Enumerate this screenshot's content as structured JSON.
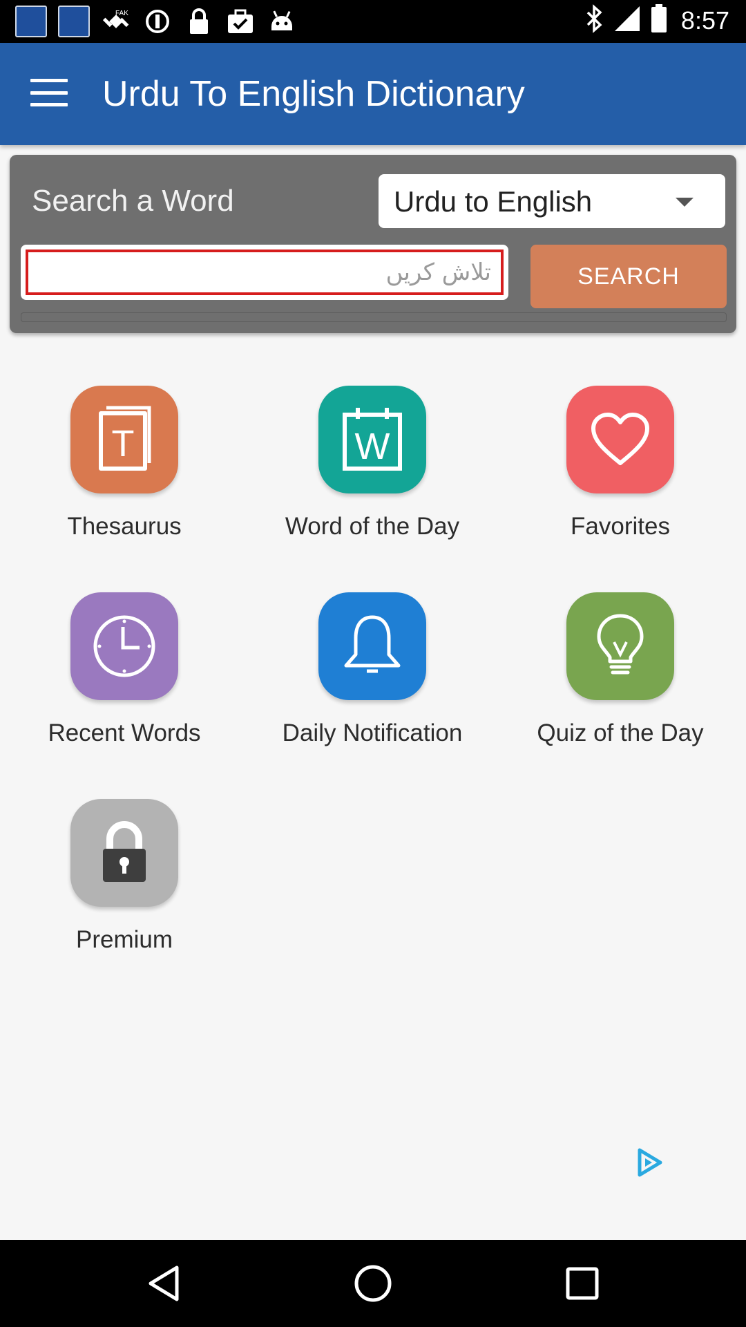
{
  "status_bar": {
    "time": "8:57",
    "left_icons": [
      "app-notification-icon",
      "app-notification-icon",
      "fake-gps-icon",
      "sync-icon",
      "lock-icon",
      "briefcase-check-icon",
      "android-icon"
    ],
    "right_icons": [
      "bluetooth-icon",
      "signal-icon",
      "battery-icon"
    ]
  },
  "app_bar": {
    "title": "Urdu To English Dictionary",
    "color": "#245ea8"
  },
  "search": {
    "label": "Search a Word",
    "language_selected": "Urdu to English",
    "input_placeholder": "تلاش کریں",
    "input_value": "",
    "button_label": "SEARCH",
    "button_color": "#d38059"
  },
  "menu": {
    "items": [
      {
        "label": "Thesaurus",
        "icon": "book-icon",
        "color": "#d9794f"
      },
      {
        "label": "Word of the Day",
        "icon": "calendar-w-icon",
        "color": "#13a596"
      },
      {
        "label": "Favorites",
        "icon": "heart-icon",
        "color": "#f05f63"
      },
      {
        "label": "Recent Words",
        "icon": "clock-icon",
        "color": "#9a79bf"
      },
      {
        "label": "Daily Notification",
        "icon": "bell-icon",
        "color": "#1f7fd4"
      },
      {
        "label": "Quiz of the Day",
        "icon": "lightbulb-icon",
        "color": "#79a54f"
      },
      {
        "label": "Premium",
        "icon": "padlock-icon",
        "color": "#b3b3b3"
      }
    ]
  },
  "ad": {
    "icon": "ad-choices-icon"
  },
  "nav_bar": {
    "icons": [
      "back-icon",
      "home-icon",
      "recents-icon"
    ]
  }
}
